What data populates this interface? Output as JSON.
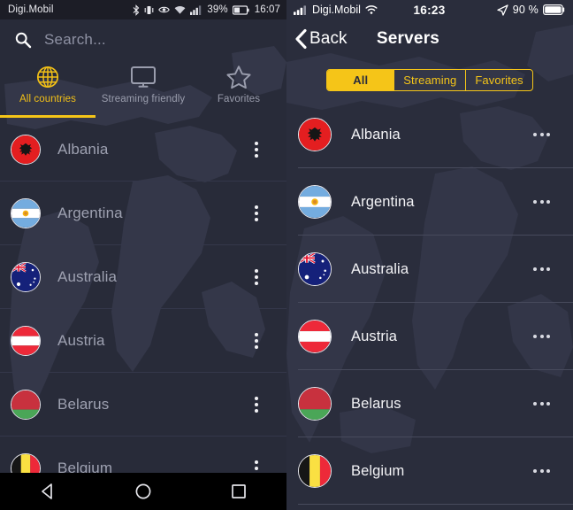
{
  "colors": {
    "accent": "#f5c518",
    "bg_left": "#282b39",
    "bg_right": "#2a2d3c",
    "status_bar_left": "#1c1d26",
    "text_muted": "#9ea1b1",
    "text_light": "#f3f3f6"
  },
  "left": {
    "status": {
      "carrier": "Digi.Mobil",
      "battery_percent": "39%",
      "clock": "16:07",
      "icons": [
        "bluetooth-icon",
        "vibrate-icon",
        "eye-icon",
        "wifi-icon",
        "signal-icon",
        "battery-icon"
      ]
    },
    "search": {
      "placeholder": "Search...",
      "icon": "search-icon",
      "value": ""
    },
    "tabs": [
      {
        "label": "All countries",
        "icon": "globe-icon",
        "active": true
      },
      {
        "label": "Streaming friendly",
        "icon": "monitor-icon",
        "active": false
      },
      {
        "label": "Favorites",
        "icon": "star-icon",
        "active": false
      }
    ],
    "rows": [
      {
        "name": "Albania",
        "flag": "al"
      },
      {
        "name": "Argentina",
        "flag": "ar"
      },
      {
        "name": "Australia",
        "flag": "au"
      },
      {
        "name": "Austria",
        "flag": "at"
      },
      {
        "name": "Belarus",
        "flag": "by"
      },
      {
        "name": "Belgium",
        "flag": "be"
      }
    ],
    "row_menu_icon": "more-vertical-icon",
    "navbar": [
      "back-triangle-icon",
      "home-circle-icon",
      "recents-square-icon"
    ]
  },
  "right": {
    "status": {
      "carrier": "Digi.Mobil",
      "clock": "16:23",
      "battery_percent": "90 %",
      "icons": [
        "signal-icon",
        "wifi-icon",
        "location-arrow-icon",
        "battery-icon"
      ]
    },
    "navbar": {
      "back_label": "Back",
      "back_icon": "chevron-left-icon",
      "title": "Servers"
    },
    "segments": [
      {
        "label": "All",
        "selected": true
      },
      {
        "label": "Streaming",
        "selected": false
      },
      {
        "label": "Favorites",
        "selected": false
      }
    ],
    "rows": [
      {
        "name": "Albania",
        "flag": "al"
      },
      {
        "name": "Argentina",
        "flag": "ar"
      },
      {
        "name": "Australia",
        "flag": "au"
      },
      {
        "name": "Austria",
        "flag": "at"
      },
      {
        "name": "Belarus",
        "flag": "by"
      },
      {
        "name": "Belgium",
        "flag": "be"
      }
    ],
    "row_menu_icon": "more-horizontal-icon"
  }
}
